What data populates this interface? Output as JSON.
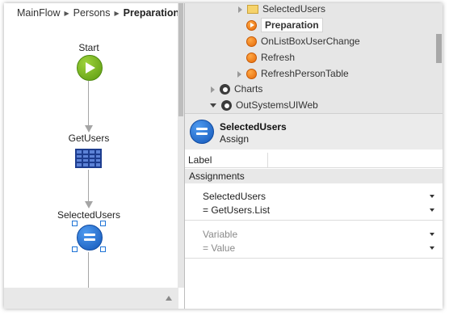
{
  "breadcrumb": {
    "root": "MainFlow",
    "middle": "Persons",
    "current": "Preparation"
  },
  "flow": {
    "start_label": "Start",
    "aggregate_label": "GetUsers",
    "assign_label": "SelectedUsers"
  },
  "tree": {
    "items": [
      {
        "label": "SelectedUsers",
        "icon": "folder-icon"
      },
      {
        "label": "Preparation",
        "icon": "preparation-action-icon",
        "selected": true
      },
      {
        "label": "OnListBoxUserChange",
        "icon": "action-icon"
      },
      {
        "label": "Refresh",
        "icon": "action-icon"
      },
      {
        "label": "RefreshPersonTable",
        "icon": "action-icon"
      },
      {
        "label": "Charts",
        "icon": "module-icon"
      },
      {
        "label": "OutSystemsUIWeb",
        "icon": "module-icon"
      }
    ]
  },
  "properties": {
    "title": "SelectedUsers",
    "subtitle": "Assign",
    "label_key": "Label",
    "label_value": "",
    "section": "Assignments",
    "assignment": {
      "variable": "SelectedUsers",
      "value": "=  GetUsers.List"
    },
    "placeholder": {
      "variable": "Variable",
      "value": "=  Value"
    }
  },
  "colors": {
    "start": "#6aab17",
    "assign": "#1f6fd6",
    "action": "#f07d18",
    "aggregate": "#1d3d8f"
  }
}
